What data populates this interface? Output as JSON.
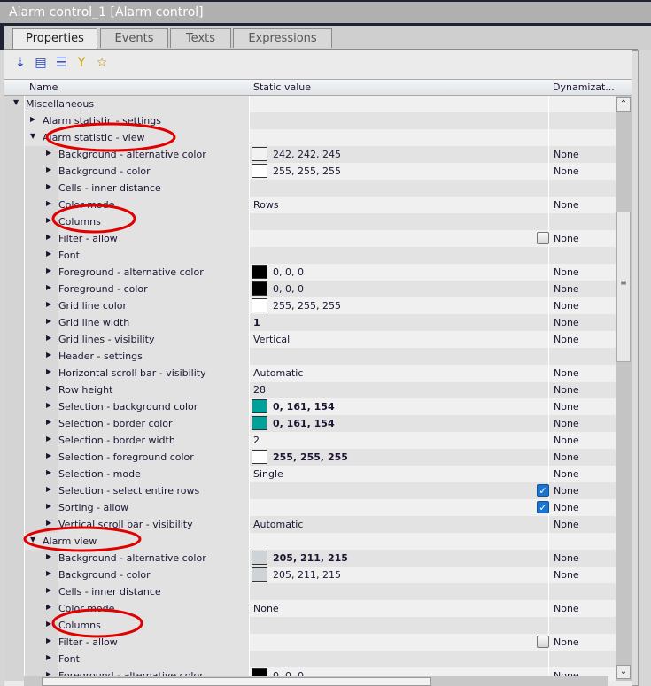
{
  "window": {
    "title": "Alarm control_1 [Alarm control]"
  },
  "tabs": [
    {
      "label": "Properties",
      "active": true
    },
    {
      "label": "Events"
    },
    {
      "label": "Texts"
    },
    {
      "label": "Expressions"
    }
  ],
  "toolbar": [
    {
      "icon": "sort-az-icon",
      "glyph": "⇣"
    },
    {
      "icon": "folder-view-icon",
      "glyph": "▤"
    },
    {
      "icon": "list-view-icon",
      "glyph": "☰"
    },
    {
      "icon": "filter-icon",
      "glyph": "Y"
    },
    {
      "icon": "favorite-star-icon",
      "glyph": "☆"
    }
  ],
  "colors": {
    "accent_teal": "#00a19a",
    "checkbox_blue": "#1b75d0",
    "annotation_red": "#e00000"
  },
  "columns": {
    "name": "Name",
    "static": "Static value",
    "dyn": "Dynamizat..."
  },
  "rows": [
    {
      "level": 0,
      "expanded": true,
      "name": "Miscellaneous"
    },
    {
      "level": 1,
      "name": "Alarm statistic - settings"
    },
    {
      "level": 1,
      "expanded": true,
      "name": "Alarm statistic - view"
    },
    {
      "level": 2,
      "name": "Background - alternative color",
      "swatch": "#f2f2f5",
      "value": "242, 242, 245",
      "dyn": "None"
    },
    {
      "level": 2,
      "name": "Background - color",
      "swatch": "#ffffff",
      "value": "255, 255, 255",
      "dyn": "None"
    },
    {
      "level": 2,
      "name": "Cells - inner distance"
    },
    {
      "level": 2,
      "name": "Color mode",
      "value": "Rows",
      "dyn": "None"
    },
    {
      "level": 2,
      "name": "Columns"
    },
    {
      "level": 2,
      "name": "Filter - allow",
      "checkbox": false,
      "dyn": "None"
    },
    {
      "level": 2,
      "name": "Font"
    },
    {
      "level": 2,
      "name": "Foreground - alternative color",
      "swatch": "#000000",
      "value": "0, 0, 0",
      "dyn": "None"
    },
    {
      "level": 2,
      "name": "Foreground - color",
      "swatch": "#000000",
      "value": "0, 0, 0",
      "dyn": "None"
    },
    {
      "level": 2,
      "name": "Grid line color",
      "swatch": "#ffffff",
      "value": "255, 255, 255",
      "dyn": "None"
    },
    {
      "level": 2,
      "name": "Grid line width",
      "value": "1",
      "bold": true,
      "dyn": "None"
    },
    {
      "level": 2,
      "name": "Grid lines - visibility",
      "value": "Vertical",
      "dyn": "None"
    },
    {
      "level": 2,
      "name": "Header - settings"
    },
    {
      "level": 2,
      "name": "Horizontal scroll bar - visibility",
      "value": "Automatic",
      "dyn": "None"
    },
    {
      "level": 2,
      "name": "Row height",
      "value": "28",
      "dyn": "None"
    },
    {
      "level": 2,
      "name": "Selection - background color",
      "swatch": "#00a19a",
      "value": "0, 161, 154",
      "bold": true,
      "dyn": "None"
    },
    {
      "level": 2,
      "name": "Selection - border color",
      "swatch": "#00a19a",
      "value": "0, 161, 154",
      "bold": true,
      "dyn": "None"
    },
    {
      "level": 2,
      "name": "Selection - border width",
      "value": "2",
      "dyn": "None"
    },
    {
      "level": 2,
      "name": "Selection - foreground color",
      "swatch": "#ffffff",
      "value": "255, 255, 255",
      "bold": true,
      "dyn": "None"
    },
    {
      "level": 2,
      "name": "Selection - mode",
      "value": "Single",
      "dyn": "None"
    },
    {
      "level": 2,
      "name": "Selection - select entire rows",
      "checkbox": true,
      "dyn": "None"
    },
    {
      "level": 2,
      "name": "Sorting - allow",
      "checkbox": true,
      "dyn": "None"
    },
    {
      "level": 2,
      "name": "Vertical scroll bar - visibility",
      "value": "Automatic",
      "dyn": "None"
    },
    {
      "level": 1,
      "expanded": true,
      "name": "Alarm view"
    },
    {
      "level": 2,
      "name": "Background - alternative color",
      "swatch": "#cdd3d7",
      "value": "205, 211, 215",
      "bold": true,
      "dyn": "None"
    },
    {
      "level": 2,
      "name": "Background - color",
      "swatch": "#cdd3d7",
      "value": "205, 211, 215",
      "dyn": "None"
    },
    {
      "level": 2,
      "name": "Cells - inner distance"
    },
    {
      "level": 2,
      "name": "Color mode",
      "value": "None",
      "dyn": "None"
    },
    {
      "level": 2,
      "name": "Columns"
    },
    {
      "level": 2,
      "name": "Filter - allow",
      "checkbox": false,
      "dyn": "None"
    },
    {
      "level": 2,
      "name": "Font"
    },
    {
      "level": 2,
      "name": "Foreground - alternative color",
      "swatch": "#000000",
      "value": "0, 0, 0",
      "dyn": "None"
    }
  ]
}
